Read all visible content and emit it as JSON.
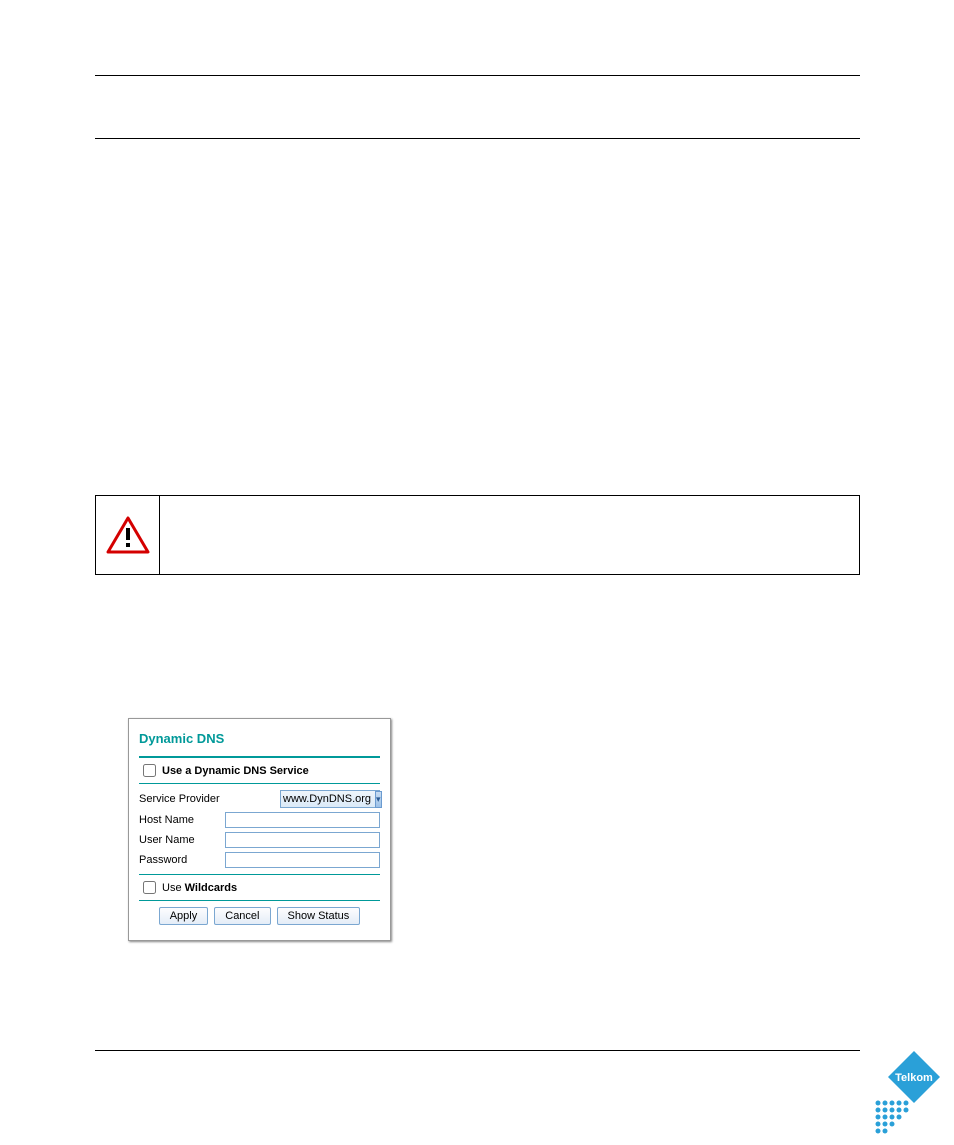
{
  "ddns": {
    "title": "Dynamic DNS",
    "use_service_label": "Use a Dynamic DNS Service",
    "use_service_checked": false,
    "service_provider_label": "Service Provider",
    "service_provider_value": "www.DynDNS.org",
    "host_name_label": "Host Name",
    "host_name_value": "",
    "user_name_label": "User Name",
    "user_name_value": "",
    "password_label": "Password",
    "password_value": "",
    "use_wildcards_label": "Use Wildcards",
    "use_wildcards_checked": false,
    "buttons": {
      "apply": "Apply",
      "cancel": "Cancel",
      "show_status": "Show Status"
    }
  },
  "logo": {
    "brand": "Telkom"
  }
}
